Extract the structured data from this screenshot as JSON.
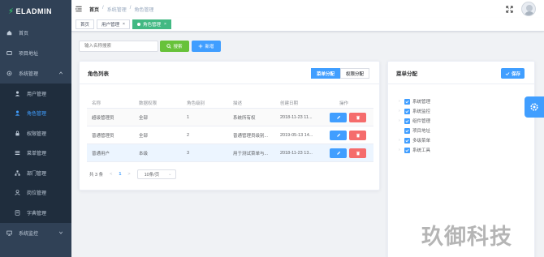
{
  "app": {
    "logo_text": "ELADMIN"
  },
  "sidebar": {
    "items": [
      {
        "label": "首页",
        "icon": "home-icon"
      },
      {
        "label": "项目地址",
        "icon": "link-icon"
      },
      {
        "label": "系统管理",
        "icon": "system-icon"
      }
    ],
    "sub_items": [
      {
        "label": "用户管理",
        "icon": "user-icon"
      },
      {
        "label": "角色管理",
        "icon": "role-icon",
        "active": true
      },
      {
        "label": "权限管理",
        "icon": "permission-icon"
      },
      {
        "label": "菜单管理",
        "icon": "menu-icon"
      },
      {
        "label": "部门管理",
        "icon": "dept-icon"
      },
      {
        "label": "岗位管理",
        "icon": "job-icon"
      },
      {
        "label": "字典管理",
        "icon": "dict-icon"
      }
    ],
    "bottom_item": {
      "label": "系统监控",
      "icon": "monitor-icon"
    }
  },
  "breadcrumb": [
    "首页",
    "/",
    "系统管理",
    "/",
    "角色管理"
  ],
  "tags": [
    {
      "label": "首页"
    },
    {
      "label": "用户管理",
      "close": "×"
    },
    {
      "label": "角色管理",
      "close": "×",
      "active": true
    }
  ],
  "toolbar": {
    "search_placeholder": "输入名称搜索",
    "search_button": "搜索",
    "add_button": "新增"
  },
  "role_card": {
    "title": "角色列表",
    "seg_menu": "菜单分配",
    "seg_perm": "权限分配"
  },
  "table": {
    "headers": [
      "名称",
      "数据权限",
      "角色级别",
      "描述",
      "创建日期",
      "操作"
    ],
    "rows": [
      [
        "超级管理员",
        "全部",
        "1",
        "系统所有权",
        "2018-11-23 11..."
      ],
      [
        "普通管理员",
        "全部",
        "2",
        "普通管理员级别...",
        "2019-05-13 14..."
      ],
      [
        "普通用户",
        "本级",
        "3",
        "用于测试菜单与...",
        "2018-11-23 13..."
      ]
    ]
  },
  "pagination": {
    "total": "共 3 条",
    "prev": "<",
    "page": "1",
    "next": ">",
    "page_size": "10条/页",
    "dropdown": "⌄"
  },
  "menu_card": {
    "title": "菜单分配",
    "save_button": "保存",
    "tree": [
      {
        "label": "系统管理",
        "expand": "›"
      },
      {
        "label": "系统监控",
        "expand": "›"
      },
      {
        "label": "组件管理",
        "expand": "›"
      },
      {
        "label": "项目地址",
        "expand": ""
      },
      {
        "label": "多级菜单",
        "expand": "›"
      },
      {
        "label": "系统工具",
        "expand": "›"
      }
    ]
  },
  "watermark": "玖御科技",
  "colors": {
    "sidebar_bg": "#304156",
    "primary": "#409eff",
    "success": "#67c23a",
    "danger": "#f56c6c",
    "tag_active": "#42b983"
  }
}
